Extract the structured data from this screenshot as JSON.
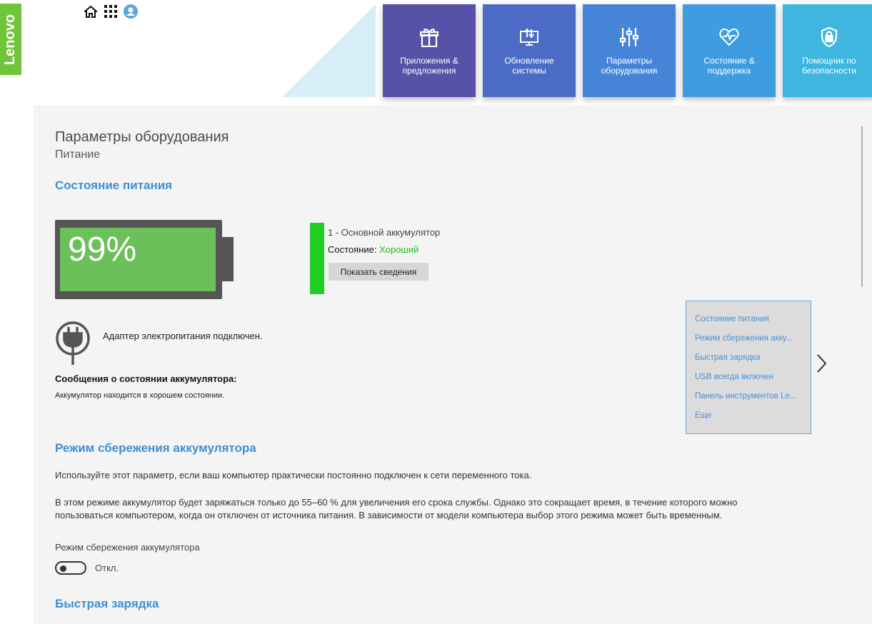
{
  "logo": {
    "text": "Lenovo"
  },
  "top_icons": [
    "home-icon",
    "apps-grid-icon",
    "user-icon"
  ],
  "tiles": [
    {
      "label": "Приложения & предложения",
      "icon": "gift-icon",
      "color": "#5552a8"
    },
    {
      "label": "Обновление системы",
      "icon": "monitor-update-icon",
      "color": "#4c6bc6"
    },
    {
      "label": "Параметры оборудования",
      "icon": "sliders-icon",
      "color": "#4684d8"
    },
    {
      "label": "Состояние & поддержка",
      "icon": "heart-pulse-icon",
      "color": "#3e9ce0"
    },
    {
      "label": "Помощник по безопасности",
      "icon": "shield-lock-icon",
      "color": "#3eb6e0"
    }
  ],
  "page": {
    "title": "Параметры оборудования",
    "subtitle": "Питание"
  },
  "power_status": {
    "section_title": "Состояние питания",
    "battery_percent": "99%",
    "battery_level": 0.99,
    "battery_name": "1 - Основной аккумулятор",
    "state_label": "Состояние:",
    "state_value": "Хороший",
    "details_button": "Показать сведения",
    "adapter_text": "Адаптер электропитания  подключен.",
    "messages_title": "Сообщения о состоянии аккумулятора:",
    "messages_text": "Аккумулятор находится в хорошем состоянии."
  },
  "nav": {
    "items": [
      "Состояние питания",
      "Режим сбережения акку...",
      "Быстрая зарядка",
      "USB всегда включен",
      "Панель инструментов Le...",
      "Еще"
    ]
  },
  "conservation": {
    "section_title": "Режим сбережения аккумулятора",
    "para1": "Используйте этот параметр, если ваш компьютер практически постоянно подключен к сети переменного тока.",
    "para2": "В этом режиме аккумулятор будет заряжаться только до 55–60 % для увеличения его срока службы. Однако это сокращает время, в течение которого можно пользоваться компьютером, когда он отключен от источника питания. В зависимости от модели компьютера выбор этого режима может быть временным.",
    "toggle_label": "Режим сбережения аккумулятора",
    "toggle_state": "Откл."
  },
  "rapid_charge": {
    "section_title": "Быстрая зарядка"
  }
}
